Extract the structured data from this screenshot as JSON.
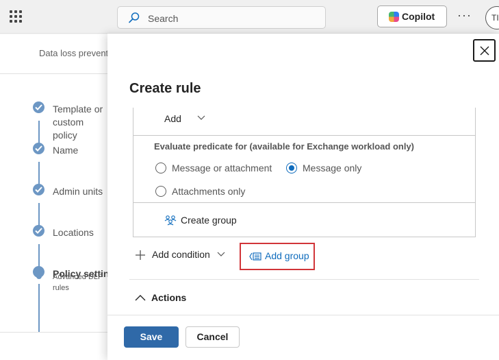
{
  "topbar": {
    "search_placeholder": "Search",
    "copilot_label": "Copilot",
    "more_label": "···",
    "avatar_initials": "TI"
  },
  "background": {
    "breadcrumb": "Data loss prevention",
    "steps": [
      {
        "label": "Template or custom policy",
        "state": "completed"
      },
      {
        "label": "Name",
        "state": "completed"
      },
      {
        "label": "Admin units",
        "state": "completed"
      },
      {
        "label": "Locations",
        "state": "completed"
      },
      {
        "label": "Policy settings",
        "state": "current"
      },
      {
        "label": "Advanced DLP rules",
        "state": "substep"
      }
    ]
  },
  "panel": {
    "title": "Create rule",
    "add_label": "Add",
    "evaluate_label": "Evaluate predicate for (available for Exchange workload only)",
    "radio_options": [
      {
        "label": "Message or attachment",
        "checked": false
      },
      {
        "label": "Message only",
        "checked": true
      },
      {
        "label": "Attachments only",
        "checked": false
      }
    ],
    "create_group_label": "Create group",
    "add_condition_label": "Add condition",
    "add_group_label": "Add group",
    "actions_label": "Actions",
    "save_label": "Save",
    "cancel_label": "Cancel"
  },
  "colors": {
    "accent": "#0f6cbd",
    "primary_button": "#2f69a8",
    "highlight_border": "#d13438",
    "step_dot": "#6d97c4"
  }
}
